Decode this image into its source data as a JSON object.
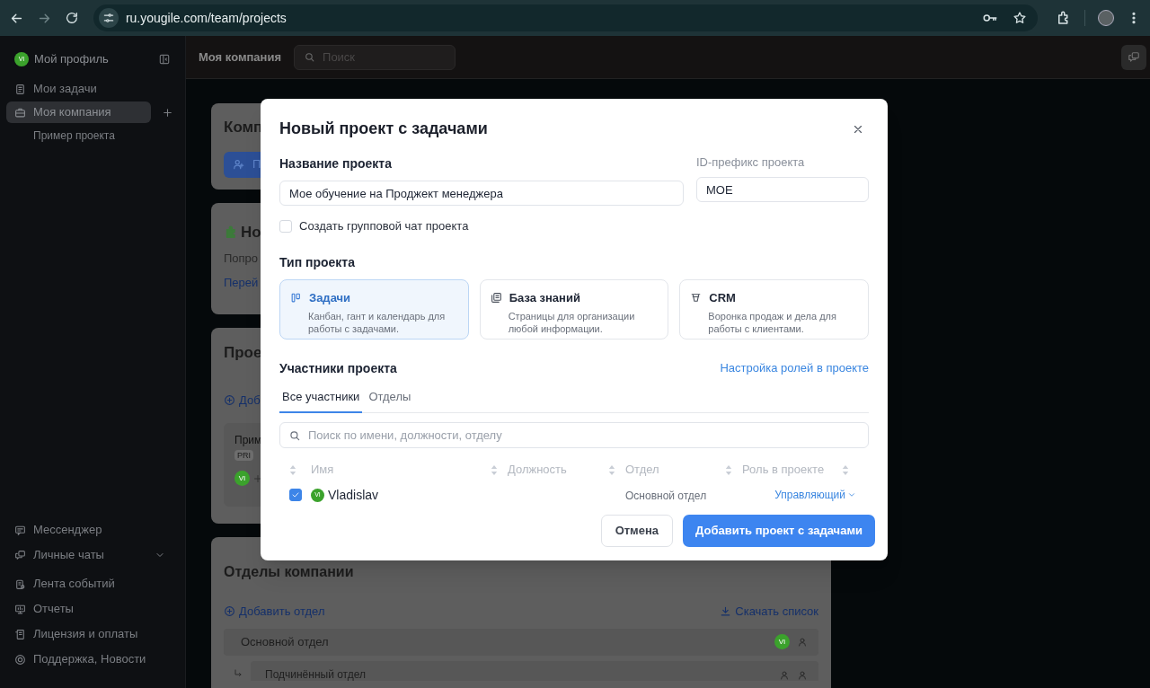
{
  "browser": {
    "url": "ru.yougile.com/team/projects"
  },
  "sidebar": {
    "profile": {
      "avatar": "VI",
      "label": "Мой профиль"
    },
    "items": [
      {
        "label": "Мои задачи",
        "selected": false
      },
      {
        "label": "Моя компания",
        "selected": true,
        "children": [
          {
            "label": "Пример проекта",
            "selected": false
          }
        ]
      }
    ],
    "bottom_items": [
      {
        "label": "Мессенджер"
      },
      {
        "label": "Личные чаты"
      },
      {
        "label": "Лента событий"
      },
      {
        "label": "Отчеты"
      },
      {
        "label": "Лицензия и оплаты"
      },
      {
        "label": "Поддержка, Новости"
      }
    ]
  },
  "header": {
    "title": "Моя компания",
    "search_placeholder": "Поиск"
  },
  "company_card": {
    "title": "Комп",
    "button": "П"
  },
  "news_card": {
    "title": "Но",
    "text": "Попро",
    "link": "Перей"
  },
  "projects_card": {
    "title": "Прое",
    "add_link": "Доб",
    "project": {
      "name": "Прим",
      "prefix": "PRI",
      "avatar": "VI"
    }
  },
  "departments_card": {
    "title": "Отделы компании",
    "add_link": "Добавить отдел",
    "download_link": "Скачать список",
    "departments": [
      {
        "name": "Основной отдел",
        "avatar": "VI",
        "children": [
          {
            "name": "Подчинённый отдел"
          }
        ]
      }
    ]
  },
  "dialog": {
    "title": "Новый проект с задачами",
    "name_field": {
      "label": "Название проекта",
      "value": "Мое обучение на Проджект менеджера"
    },
    "prefix_field": {
      "label": "ID-префикс проекта",
      "value": "MOE"
    },
    "group_chat": {
      "label": "Создать групповой чат проекта",
      "checked": false
    },
    "type_section": {
      "title": "Тип проекта",
      "options": [
        {
          "title": "Задачи",
          "description": "Канбан, гант и календарь для работы с задачами.",
          "selected": true
        },
        {
          "title": "База знаний",
          "description": "Страницы для организации любой информации.",
          "selected": false
        },
        {
          "title": "CRM",
          "description": "Воронка продаж и дела для работы с клиентами.",
          "selected": false
        }
      ]
    },
    "members": {
      "title": "Участники проекта",
      "roles_link": "Настройка ролей в проекте",
      "tabs": [
        {
          "label": "Все участники",
          "selected": true
        },
        {
          "label": "Отделы",
          "selected": false
        }
      ],
      "search_placeholder": "Поиск по имени, должности, отделу",
      "columns": [
        "Имя",
        "Должность",
        "Отдел",
        "Роль в проекте"
      ],
      "rows": [
        {
          "checked": true,
          "avatar": "VI",
          "name": "Vladislav",
          "department": "Основной отдел",
          "role": "Управляющий"
        }
      ]
    },
    "buttons": {
      "cancel": "Отмена",
      "submit": "Добавить проект с задачами"
    }
  }
}
